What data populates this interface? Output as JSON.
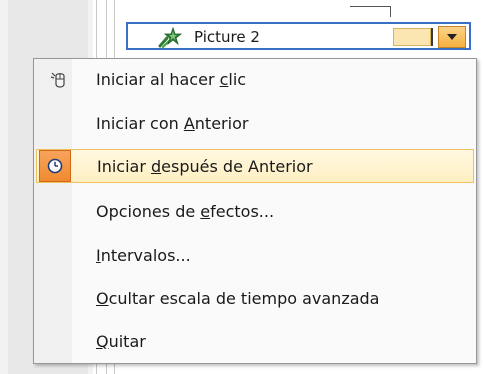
{
  "animation_item": {
    "name": "Picture 2",
    "icon": "star-effect-icon",
    "dropdown_icon": "chevron-down-icon"
  },
  "menu": {
    "items": [
      {
        "label_pre": "Iniciar al hacer ",
        "label_key": "c",
        "label_post": "lic",
        "icon": "mouse-icon",
        "highlighted": false
      },
      {
        "label_pre": "Iniciar con ",
        "label_key": "A",
        "label_post": "nterior",
        "icon": "",
        "highlighted": false
      },
      {
        "label_pre": "Iniciar ",
        "label_key": "d",
        "label_post": "espués de Anterior",
        "icon": "clock-icon",
        "highlighted": true
      },
      {
        "label_pre": "Opciones de ",
        "label_key": "e",
        "label_post": "fectos...",
        "icon": "",
        "highlighted": false
      },
      {
        "label_pre": "",
        "label_key": "I",
        "label_post": "ntervalos...",
        "icon": "",
        "highlighted": false
      },
      {
        "label_pre": "",
        "label_key": "O",
        "label_post": "cultar escala de tiempo avanzada",
        "icon": "",
        "highlighted": false
      },
      {
        "label_pre": "",
        "label_key": "Q",
        "label_post": "uitar",
        "icon": "",
        "highlighted": false
      }
    ]
  },
  "colors": {
    "highlight_border": "#f1c15f",
    "highlight_fill": "#ffefc2",
    "clock_accent": "#f08a2f",
    "selection_border": "#3a6fc6"
  }
}
